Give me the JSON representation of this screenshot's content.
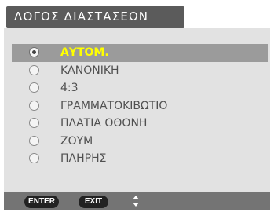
{
  "title": "ΛΟΓΟΣ ΔΙΑΣΤΑΣΕΩΝ",
  "menu": {
    "items": [
      {
        "label": "ΑΥΤΟΜ.",
        "selected": true
      },
      {
        "label": "ΚΑΝΟΝΙΚΗ",
        "selected": false
      },
      {
        "label": "4:3",
        "selected": false
      },
      {
        "label": "ΓΡΑΜΜΑΤΟΚΙΒΩΤΙΟ",
        "selected": false
      },
      {
        "label": "ΠΛΑΤΙΑ ΟΘΟΝΗ",
        "selected": false
      },
      {
        "label": "ΖΟΥΜ",
        "selected": false
      },
      {
        "label": "ΠΛΗΡΗΣ",
        "selected": false
      }
    ]
  },
  "footer": {
    "enter_label": "ENTER",
    "exit_label": "EXIT",
    "navigate_icon": "up-down-arrows-icon"
  },
  "colors": {
    "selected_text": "#ffff00",
    "selected_row": "#9b9b9b",
    "panel": "#e2e2e2",
    "title_bar": "#5b5b5b",
    "footer_bar": "#747474"
  }
}
